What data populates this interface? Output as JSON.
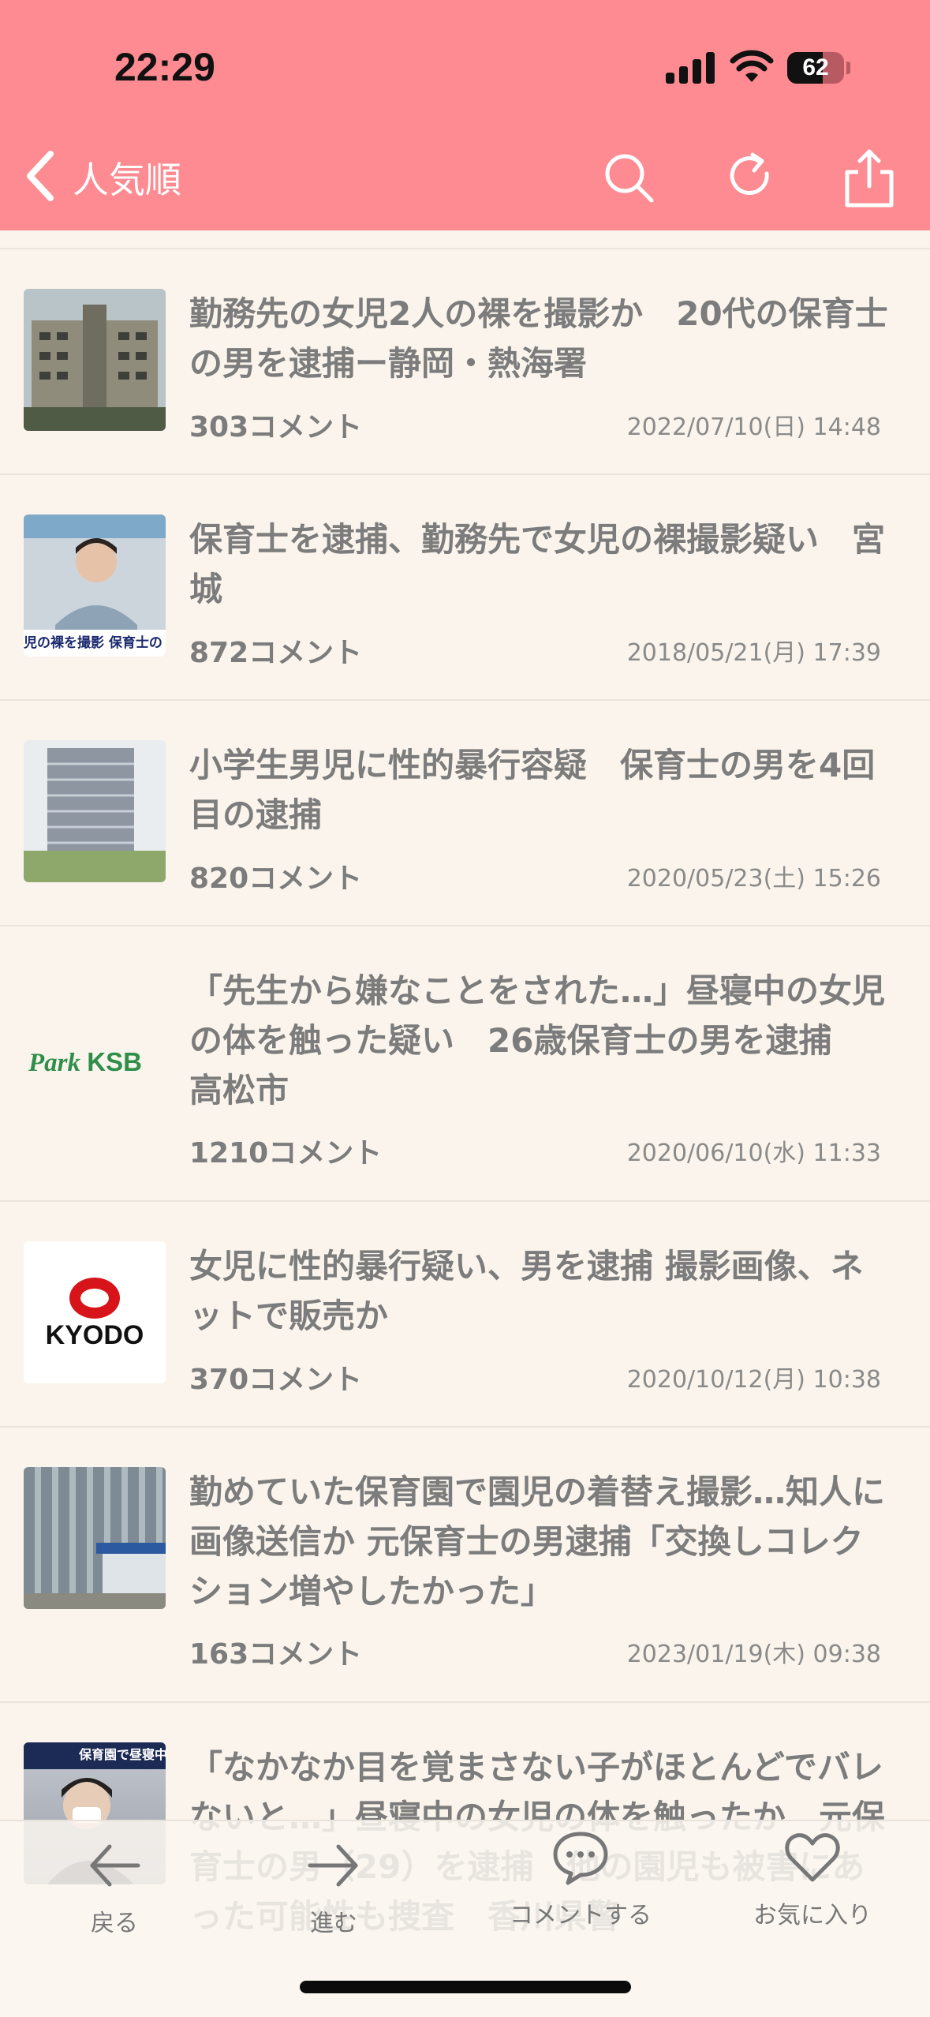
{
  "status_bar": {
    "time": "22:29",
    "battery_percent": 62,
    "battery_level": 0.62
  },
  "nav": {
    "back_label": "",
    "title": "人気順"
  },
  "icons": [
    "chevron-left-icon",
    "search-icon",
    "refresh-icon",
    "share-icon",
    "arrow-left-icon",
    "arrow-right-icon",
    "comment-bubble-icon",
    "heart-icon"
  ],
  "articles": [
    {
      "title": "勤務先の女児2人の裸を撮影か　20代の保育士の男を逮捕ー静岡・熱海署",
      "comments": "303コメント",
      "date": "2022/07/10(日) 14:48",
      "thumb": "building"
    },
    {
      "title": "保育士を逮捕、勤務先で女児の裸撮影疑い　宮城",
      "comments": "872コメント",
      "date": "2018/05/21(月) 17:39",
      "thumb": "news-anchor",
      "thumb_text": "児の裸を撮影 保育士の"
    },
    {
      "title": "小学生男児に性的暴行容疑　保育士の男を4回目の逮捕",
      "comments": "820コメント",
      "date": "2020/05/23(土) 15:26",
      "thumb": "office-building"
    },
    {
      "title": "「先生から嫌なことをされた…」昼寝中の女児の体を触った疑い　26歳保育士の男を逮捕　高松市",
      "comments": "1210コメント",
      "date": "2020/06/10(水) 11:33",
      "thumb": "logo",
      "thumb_text_a": "Park",
      "thumb_text_b": "KSB"
    },
    {
      "title": "女児に性的暴行疑い、男を逮捕 撮影画像、ネットで販売か",
      "comments": "370コメント",
      "date": "2020/10/12(月) 10:38",
      "thumb": "logo",
      "thumb_text": "KYODO"
    },
    {
      "title": "勤めていた保育園で園児の着替え撮影…知人に画像送信か 元保育士の男逮捕「交換しコレクション増やしたかった」",
      "comments": "163コメント",
      "date": "2023/01/19(木) 09:38",
      "thumb": "glass-building"
    },
    {
      "title": "「なかなか目を覚まさない子がほとんどでバレないと…」昼寝中の女児の体を触ったか　元保育士の男（29）を逮捕　他の園児も被害にあった可能性も捜査　香川県警",
      "comments": "",
      "date": "",
      "thumb": "people",
      "thumb_text": "保育園で昼寝中の女"
    }
  ],
  "toolbar": {
    "back": "戻る",
    "forward": "進む",
    "comment": "コメントする",
    "favorite": "お気に入り"
  }
}
